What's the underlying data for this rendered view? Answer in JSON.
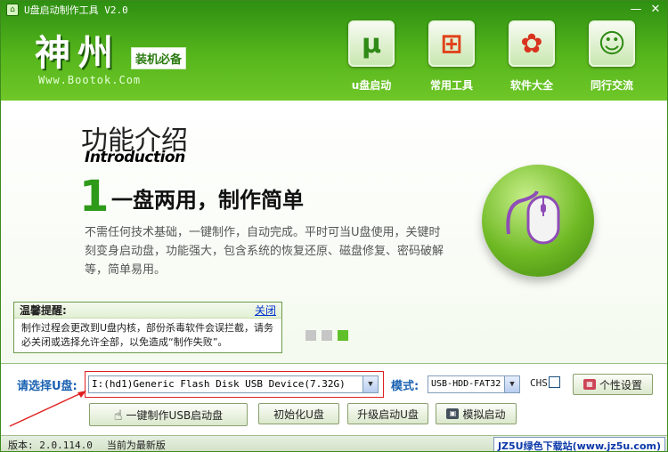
{
  "window": {
    "title": "U盘启动制作工具 V2.0",
    "minimize": "—",
    "close": "✕"
  },
  "brand": {
    "logo": "神州",
    "tag": "装机必备",
    "url": "Www.Bootok.Com"
  },
  "nav": [
    {
      "label": "u盘启动",
      "icon": "utorrent-icon",
      "glyph": "μ"
    },
    {
      "label": "常用工具",
      "icon": "windows-icon",
      "glyph": "⊞"
    },
    {
      "label": "软件大全",
      "icon": "picasa-icon",
      "glyph": "✿"
    },
    {
      "label": "同行交流",
      "icon": "chat-icon",
      "glyph": "☺"
    }
  ],
  "feature": {
    "heading": "功能介绍",
    "heading_en": "Introduction",
    "number": "1",
    "headline": "一盘两用，制作简单",
    "description": "不需任何技术基础，一键制作，自动完成。平时可当U盘使用，关键时刻变身启动盘，功能强大，包含系统的恢复还原、磁盘修复、密码破解等，简单易用。"
  },
  "tip": {
    "title": "温馨提醒:",
    "close": "关闭",
    "body": "制作过程会更改到U盘内核，部份杀毒软件会误拦截，请务必关闭或选择允许全部，以免造成“制作失败”。"
  },
  "carousel": {
    "count": 3,
    "active": 3
  },
  "controls": {
    "select_label": "请选择U盘:",
    "device_value": "I:(hd1)Generic Flash Disk USB Device(7.32G)",
    "mode_label": "模式:",
    "mode_value": "USB-HDD-FAT32",
    "chs_label": "CHS",
    "chs_checked": false,
    "personal_label": "个性设置",
    "make_label": "一键制作USB启动盘",
    "init_label": "初始化U盘",
    "upgrade_label": "升级启动U盘",
    "simulate_label": "模拟启动"
  },
  "status": {
    "version": "版本: 2.0.114.0",
    "update": "当前为最新版",
    "watermark": "JZ5U绿色下载站(www.jz5u.com)"
  },
  "colors": {
    "brand_green": "#56b61c",
    "label_blue": "#1b62b2",
    "highlight_red": "#e02020"
  }
}
